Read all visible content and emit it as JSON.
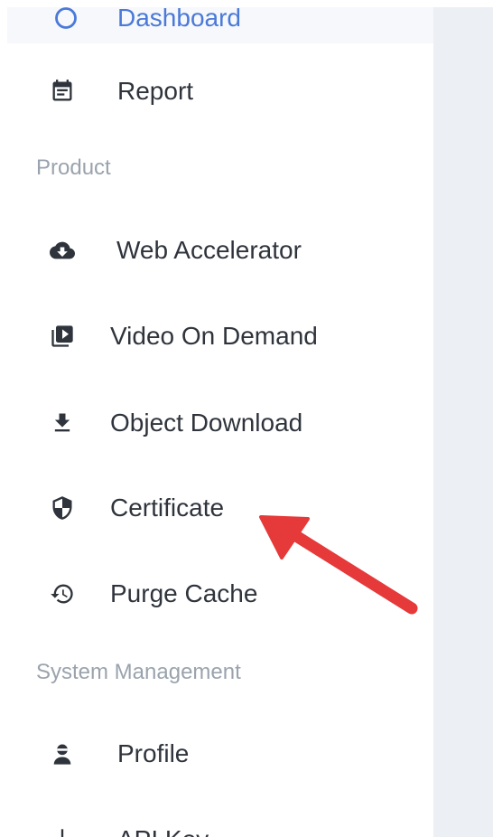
{
  "sidebar": {
    "items": [
      {
        "label": "Dashboard",
        "icon": "dashboard-icon",
        "active": true
      },
      {
        "label": "Report",
        "icon": "report-icon"
      },
      {
        "label": "Web Accelerator",
        "icon": "cloud-download-icon"
      },
      {
        "label": "Video On Demand",
        "icon": "video-library-icon"
      },
      {
        "label": "Object Download",
        "icon": "download-icon"
      },
      {
        "label": "Certificate",
        "icon": "shield-icon"
      },
      {
        "label": "Purge Cache",
        "icon": "history-icon"
      },
      {
        "label": "Profile",
        "icon": "user-icon"
      },
      {
        "label": "API Key",
        "icon": "key-icon"
      }
    ],
    "sections": [
      {
        "label": "Product"
      },
      {
        "label": "System Management"
      }
    ]
  },
  "annotation": {
    "icon": "red-arrow-icon",
    "color": "#e5393a"
  },
  "colors": {
    "accent": "#4a79d8",
    "text": "#2f343c",
    "section": "#9aa3ad",
    "panel": "#eceff3"
  }
}
